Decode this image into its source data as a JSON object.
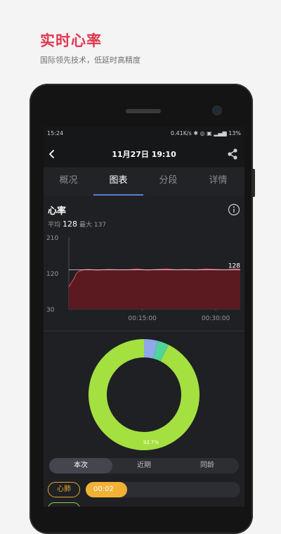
{
  "promo": {
    "title": "实时心率",
    "subtitle": "国际领先技术，低延时高精度"
  },
  "status": {
    "time": "15:24",
    "right": "0.41K/s ✱ ◎ ▣ ▂▄▆ 13%"
  },
  "nav": {
    "title": "11月27日 19:10"
  },
  "tabs": [
    "概况",
    "图表",
    "分段",
    "详情"
  ],
  "card": {
    "title": "心率",
    "avg_label": "平均",
    "avg_value": "128",
    "max_text": "最大 137"
  },
  "colors": {
    "accent_red": "#e0384f",
    "tab_underline": "#5a7fcf",
    "chart_fill": "#5a1a20",
    "chart_line": "#d0424e",
    "donut_green": "#a4e040",
    "zone_orange": "#f0b135"
  },
  "chart_data": [
    {
      "type": "area",
      "y_ticks": [
        "210",
        "120",
        "30"
      ],
      "ylim": [
        30,
        210
      ],
      "x_ticks": [
        "00:15:00",
        "00:30:00"
      ],
      "reference_line": {
        "value": 128,
        "label": "128"
      },
      "x_minutes": [
        0,
        0.5,
        1,
        1.5,
        2,
        3,
        4,
        5,
        6,
        8,
        10,
        12,
        14,
        16,
        18,
        20,
        22,
        24,
        26,
        28,
        30,
        32,
        34,
        35
      ],
      "values": [
        85,
        95,
        105,
        118,
        124,
        128,
        129,
        128,
        127,
        129,
        128,
        128,
        130,
        127,
        129,
        130,
        128,
        129,
        128,
        130,
        129,
        128,
        130,
        129
      ]
    },
    {
      "type": "pie",
      "slices": [
        {
          "label": "92.7%",
          "value": 92.7,
          "color": "#a4e040"
        },
        {
          "label": "",
          "value": 3.3,
          "color": "#4fd49a"
        },
        {
          "label": "",
          "value": 4.0,
          "color": "#8ea8e8"
        }
      ]
    }
  ],
  "segments": [
    "本次",
    "近期",
    "同龄"
  ],
  "zones": [
    {
      "label": "心肺",
      "time": "00:02",
      "fraction": 0.27
    }
  ]
}
